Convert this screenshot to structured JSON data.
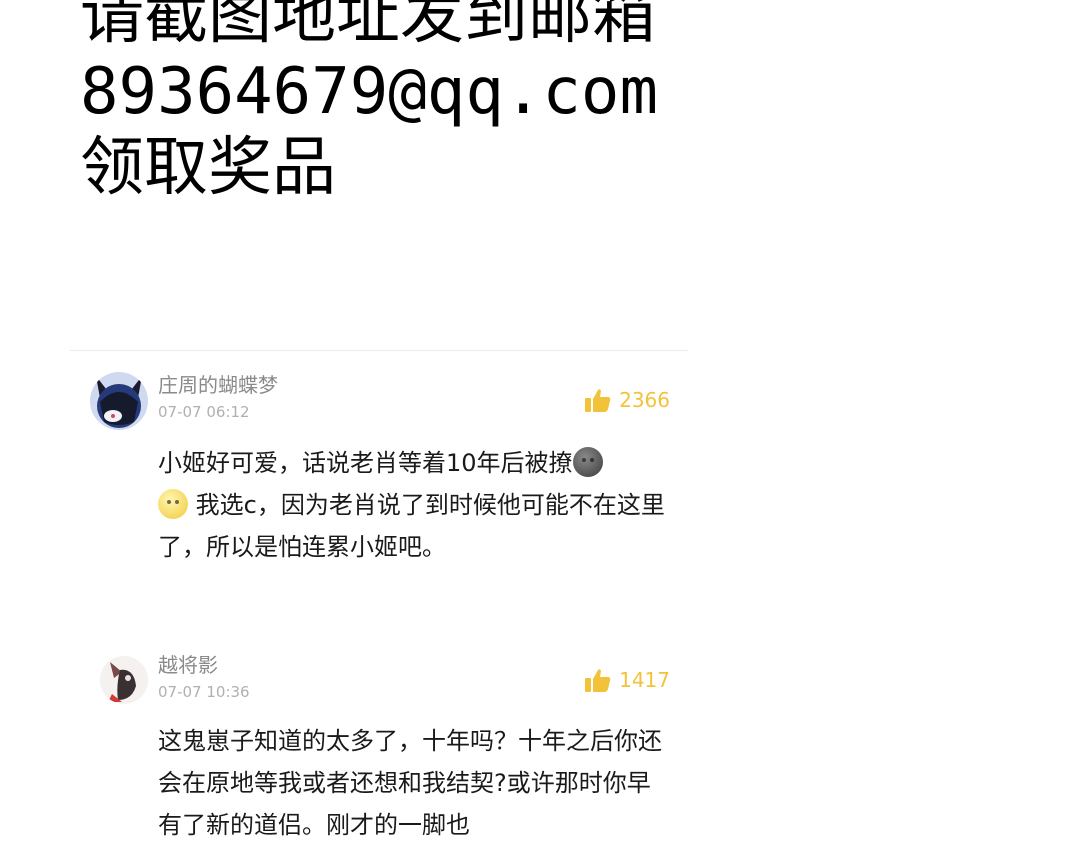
{
  "banner": {
    "line1": "请截图地址发到邮箱",
    "line2": "89364679@qq.com",
    "line3": "领取奖品"
  },
  "comments": [
    {
      "username": "庄周的蝴蝶梦",
      "time": "07-07 06:12",
      "likes": "2366",
      "text_part1": "小姬好可爱，话说老肖等着10年后被撩",
      "emoji1": "dark-moon-face",
      "emoji2": "moon-face",
      "text_part2": "我选c，因为老肖说了到时候他可能不在这里了，所以是怕连累小姬吧。"
    },
    {
      "username": "越将影",
      "time": "07-07 10:36",
      "likes": "1417",
      "text": "这鬼崽子知道的太多了，十年吗？十年之后你还会在原地等我或者还想和我结契?或许那时你早有了新的道侣。刚才的一脚也"
    }
  ],
  "colors": {
    "like": "#f2c33a",
    "meta": "#8a8a8a"
  }
}
